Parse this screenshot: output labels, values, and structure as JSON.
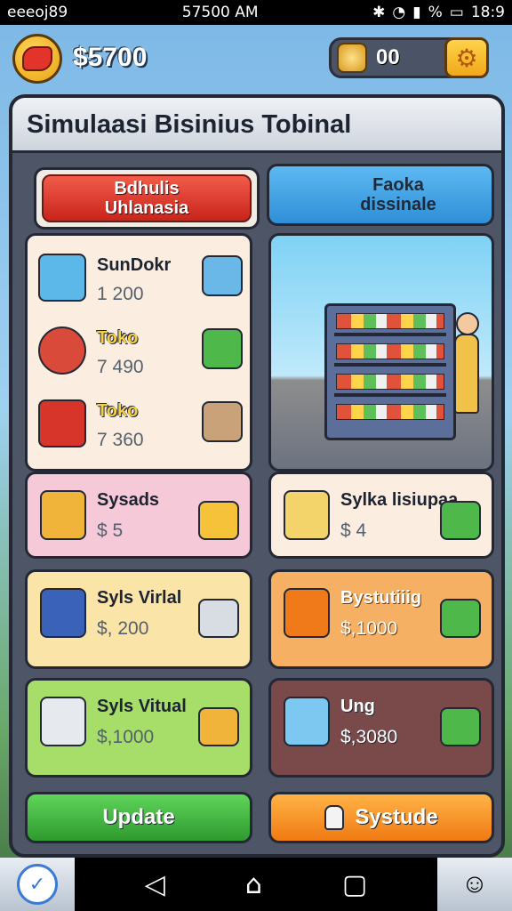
{
  "status_bar": {
    "carrier": "eeeoj89",
    "time": "57500 AM",
    "battery_pct": "%",
    "clock_right": "18:9"
  },
  "header": {
    "money": "$5700",
    "resource_value": "00"
  },
  "panel": {
    "title": "Simulaasi Bisinius Tobinal",
    "red_button": {
      "line1": "Bdhulis",
      "line2": "Uhlanasia"
    },
    "blue_button": {
      "line1": "Faoka",
      "line2": "dissinale"
    }
  },
  "list_items": [
    {
      "name": "SunDokr",
      "value": "1 200",
      "icon": "blue-box-icon",
      "side_icon": "document-icon"
    },
    {
      "name": "Toko",
      "value": "7 490",
      "icon": "clock-radio-icon",
      "side_icon": "cash-icon"
    },
    {
      "name": "Toko",
      "value": "7 360",
      "icon": "red-machine-icon",
      "side_icon": "can-icon"
    }
  ],
  "cards": [
    {
      "name": "Sysads",
      "value": "$ 5",
      "icon": "briefcase-icon",
      "side_icon": "gold-stack-icon"
    },
    {
      "name": "Sylka lisiupaa",
      "value": "$ 4",
      "icon": "bucket-icon",
      "side_icon": "green-crate-icon"
    },
    {
      "name": "Syls Virlal",
      "value": "$, 200",
      "icon": "mailbox-icon",
      "side_icon": "trash-can-icon"
    },
    {
      "name": "Bystutiiig",
      "value": "$,1000",
      "icon": "orange-pot-icon",
      "side_icon": "green-crate-icon"
    },
    {
      "name": "Syls Vitual",
      "value": "$,1000",
      "icon": "gift-box-icon",
      "side_icon": "coin-bag-icon"
    },
    {
      "name": "Ung",
      "value": "$,3080",
      "icon": "blue-cup-icon",
      "side_icon": "green-box-icon"
    }
  ],
  "actions": {
    "update": "Update",
    "systude": "Systude"
  },
  "colors": {
    "accent_red": "#e0342b",
    "accent_blue": "#3a9be0",
    "accent_green": "#3fb53a",
    "accent_orange": "#f59a2a",
    "panel_bg": "#4d5566"
  }
}
